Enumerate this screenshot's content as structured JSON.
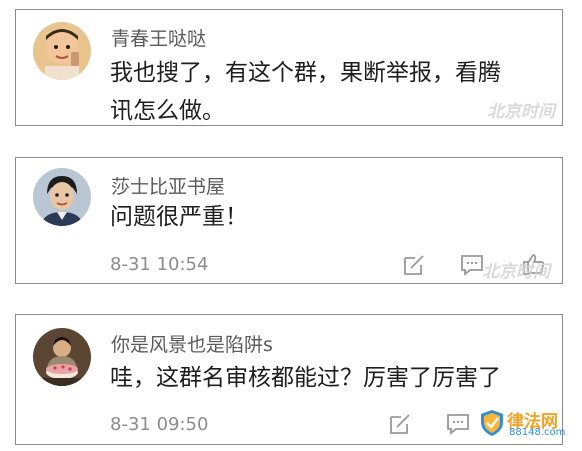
{
  "watermark": "北京时间",
  "logo": {
    "name": "律法网",
    "url": "88148.com"
  },
  "comments": [
    {
      "username": "青春王哒哒",
      "text_lines": [
        "我也搜了，有这个群，果断举报，看腾",
        "讯怎么做。"
      ]
    },
    {
      "username": "莎士比亚书屋",
      "text_lines": [
        "问题很严重！"
      ],
      "time": "8-31 10:54"
    },
    {
      "username": "你是风景也是陷阱s",
      "text_lines": [
        "哇，这群名审核都能过？厉害了厉害了"
      ],
      "time": "8-31 09:50"
    }
  ]
}
